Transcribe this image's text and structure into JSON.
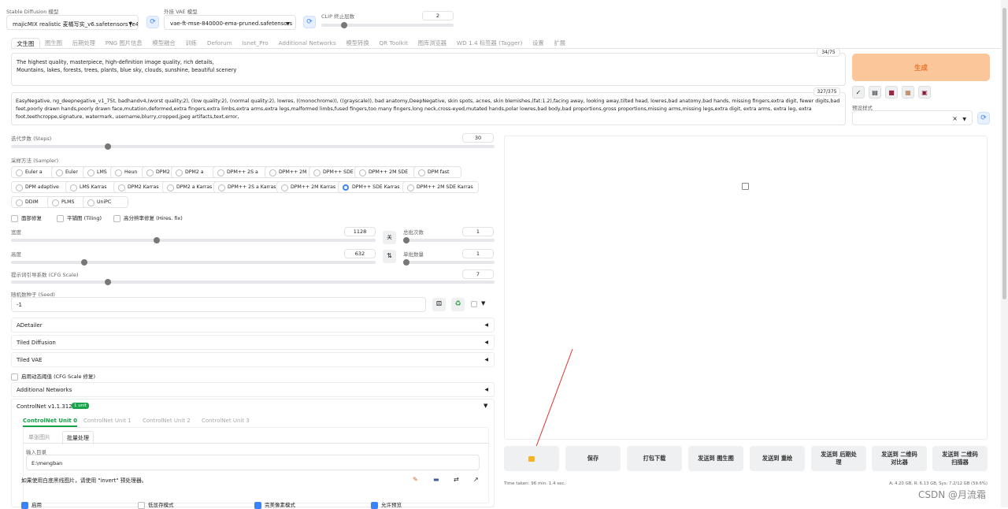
{
  "top": {
    "sd_model_label": "Stable Diffusion 模型",
    "sd_model_value": "majicMIX realistic 麦橘写实_v6.safetensors [e4a",
    "vae_label": "外挂 VAE 模型",
    "vae_value": "vae-ft-mse-840000-ema-pruned.safetensors",
    "clip_label": "CLIP 终止层数",
    "clip_value": "2",
    "clip_level": 0.17
  },
  "tabs": [
    "文生图",
    "图生图",
    "后期处理",
    "PNG 图片信息",
    "模型融合",
    "训练",
    "Deforum",
    "Isnet_Pro",
    "Additional Networks",
    "模型转换",
    "QR Toolkit",
    "图库浏览器",
    "WD 1.4 标签器 (Tagger)",
    "设置",
    "扩展"
  ],
  "prompt": {
    "positive": "The highest quality, masterpiece, high-definition image quality, rich details,\nMountains, lakes, forests, trees, plants, blue sky, clouds, sunshine, beautiful scenery",
    "positive_count": "34/75",
    "negative": "EasyNegative, ng_deepnegative_v1_75t, badhandv4,(worst quality:2), (low quality:2), (normal quality:2), lowres, ((monochrome)), ((grayscale)), bad anatomy,DeepNegative, skin spots, acnes, skin blemishes,(fat:1.2),facing away, looking away,tilted head, lowres,bad anatomy,bad hands, missing fingers,extra digit, fewer digits,bad feet,poorly drawn hands,poorly drawn face,mutation,deformed,extra fingers,extra limbs,extra arms,extra legs,malformed limbs,fused fingers,too many fingers,long neck,cross-eyed,mutated hands,polar lowres,bad body,bad proportions,gross proportions,missing arms,missing legs,extra digit, extra arms, extra leg, extra foot,teethcroppe,signature, watermark, username,blurry,cropped,jpeg artifacts,text,error,",
    "negative_count": "327/375"
  },
  "generate_label": "生成",
  "styles_label": "预设样式",
  "steps": {
    "label": "迭代步数 (Steps)",
    "value": "30",
    "level": 0.2
  },
  "sampler": {
    "label": "采样方法 (Sampler)",
    "options": [
      "Euler a",
      "Euler",
      "LMS",
      "Heun",
      "DPM2",
      "DPM2 a",
      "DPM++ 2S a",
      "DPM++ 2M",
      "DPM++ SDE",
      "DPM++ 2M SDE",
      "DPM fast",
      "DPM adaptive",
      "LMS Karras",
      "DPM2 Karras",
      "DPM2 a Karras",
      "DPM++ 2S a Karras",
      "DPM++ 2M Karras",
      "DPM++ SDE Karras",
      "DPM++ 2M SDE Karras",
      "DDIM",
      "PLMS",
      "UniPC"
    ],
    "selected": "DPM++ SDE Karras"
  },
  "checks": {
    "face": "面部修复",
    "tiling": "平铺图 (Tiling)",
    "hires": "高分辨率修复 (Hires. fix)"
  },
  "width": {
    "label": "宽度",
    "value": "1128",
    "level": 0.4
  },
  "height": {
    "label": "高度",
    "value": "632",
    "level": 0.2
  },
  "swap_label": "关",
  "batch_count": {
    "label": "总批次数",
    "value": "1",
    "level": 0.0
  },
  "batch_size": {
    "label": "单批数量",
    "value": "1",
    "level": 0.0
  },
  "cfg": {
    "label": "提示词引导系数 (CFG Scale)",
    "value": "7",
    "level": 0.2
  },
  "seed": {
    "label": "随机数种子 (Seed)",
    "value": "-1"
  },
  "accordions": [
    "ADetailer",
    "Tiled Diffusion",
    "Tiled VAE"
  ],
  "dynamic_thresh": "启用动态阈值 (CFG Scale 修复)",
  "additional_networks": "Additional Networks",
  "controlnet": {
    "title": "ControlNet v1.1.312",
    "badge": "1 unit",
    "units": [
      "ControlNet Unit 0",
      "ControlNet Unit 1",
      "ControlNet Unit 2",
      "ControlNet Unit 3"
    ],
    "subtabs": [
      "单张图片",
      "批量处理"
    ],
    "input_dir_label": "输入目录",
    "input_dir_value": "E:\\mengban",
    "hint": "如果使用白底黑线图片，请使用 \"invert\" 预处理器。",
    "bottom_checks": [
      "启用",
      "低显存模式",
      "完美像素模式",
      "允许预览"
    ]
  },
  "actions": [
    "保存",
    "打包下载",
    "发送到 图生图",
    "发送到 重绘",
    "发送到 后期处\n理",
    "发送到 二维码\n对比器",
    "发送到 二维码\n扫描器"
  ],
  "time_taken": "Time taken: 96 min. 1.4 sec.",
  "vram": "A: 4.20 GB, R: 6.13 GB, Sys: 7.2/12 GB (59.6%)",
  "watermark": "CSDN @月流霜",
  "colors": {
    "generate_bg": "#fbc79a",
    "generate_text": "#e8742a",
    "accent": "#3b82f6",
    "arrow": "#e0302a"
  }
}
